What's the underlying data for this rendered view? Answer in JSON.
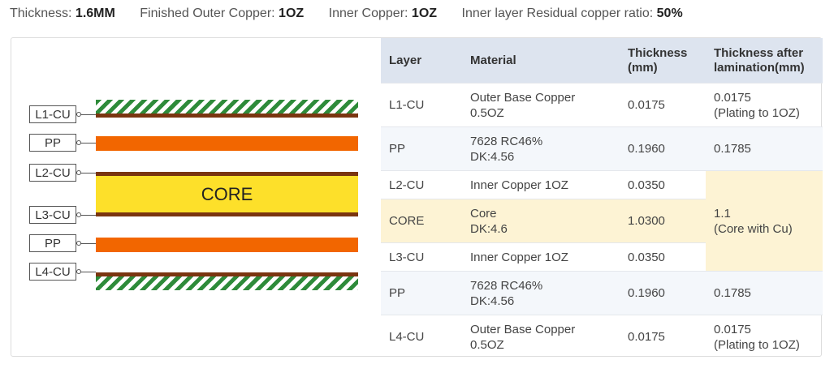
{
  "specs": [
    {
      "label": "Thickness:",
      "value": "1.6MM"
    },
    {
      "label": "Finished Outer Copper:",
      "value": "1OZ"
    },
    {
      "label": "Inner Copper:",
      "value": "1OZ"
    },
    {
      "label": "Inner layer Residual copper ratio:",
      "value": "50%"
    }
  ],
  "stackup": {
    "labels": [
      "L1-CU",
      "PP",
      "L2-CU",
      "L3-CU",
      "PP",
      "L4-CU"
    ],
    "core_label": "CORE"
  },
  "table": {
    "headers": [
      "Layer",
      "Material",
      "Thickness\n(mm)",
      "Thickness after\nlamination(mm)"
    ],
    "rows": [
      {
        "layer": "L1-CU",
        "material": "Outer Base Copper\n0.5OZ",
        "thickness": "0.0175",
        "after": "0.0175\n(Plating to 1OZ)"
      },
      {
        "layer": "PP",
        "material": "7628 RC46%\nDK:4.56",
        "thickness": "0.1960",
        "after": "0.1785"
      },
      {
        "layer": "L2-CU",
        "material": "Inner Copper 1OZ",
        "thickness": "0.0350",
        "after": "1.1\n(Core with Cu)"
      },
      {
        "layer": "CORE",
        "material": "Core\nDK:4.6",
        "thickness": "1.0300"
      },
      {
        "layer": "L3-CU",
        "material": "Inner Copper 1OZ",
        "thickness": "0.0350"
      },
      {
        "layer": "PP",
        "material": "7628 RC46%\nDK:4.56",
        "thickness": "0.1960",
        "after": "0.1785"
      },
      {
        "layer": "L4-CU",
        "material": "Outer Base Copper\n0.5OZ",
        "thickness": "0.0175",
        "after": "0.0175\n(Plating to 1OZ)"
      }
    ]
  },
  "colors": {
    "copper_hatch": "#2e8b3a",
    "copper_base": "#7a3510",
    "prepreg": "#f26600",
    "core": "#fde02a",
    "header_bg": "#dde4ef",
    "core_row_bg": "#fdf3d4"
  }
}
